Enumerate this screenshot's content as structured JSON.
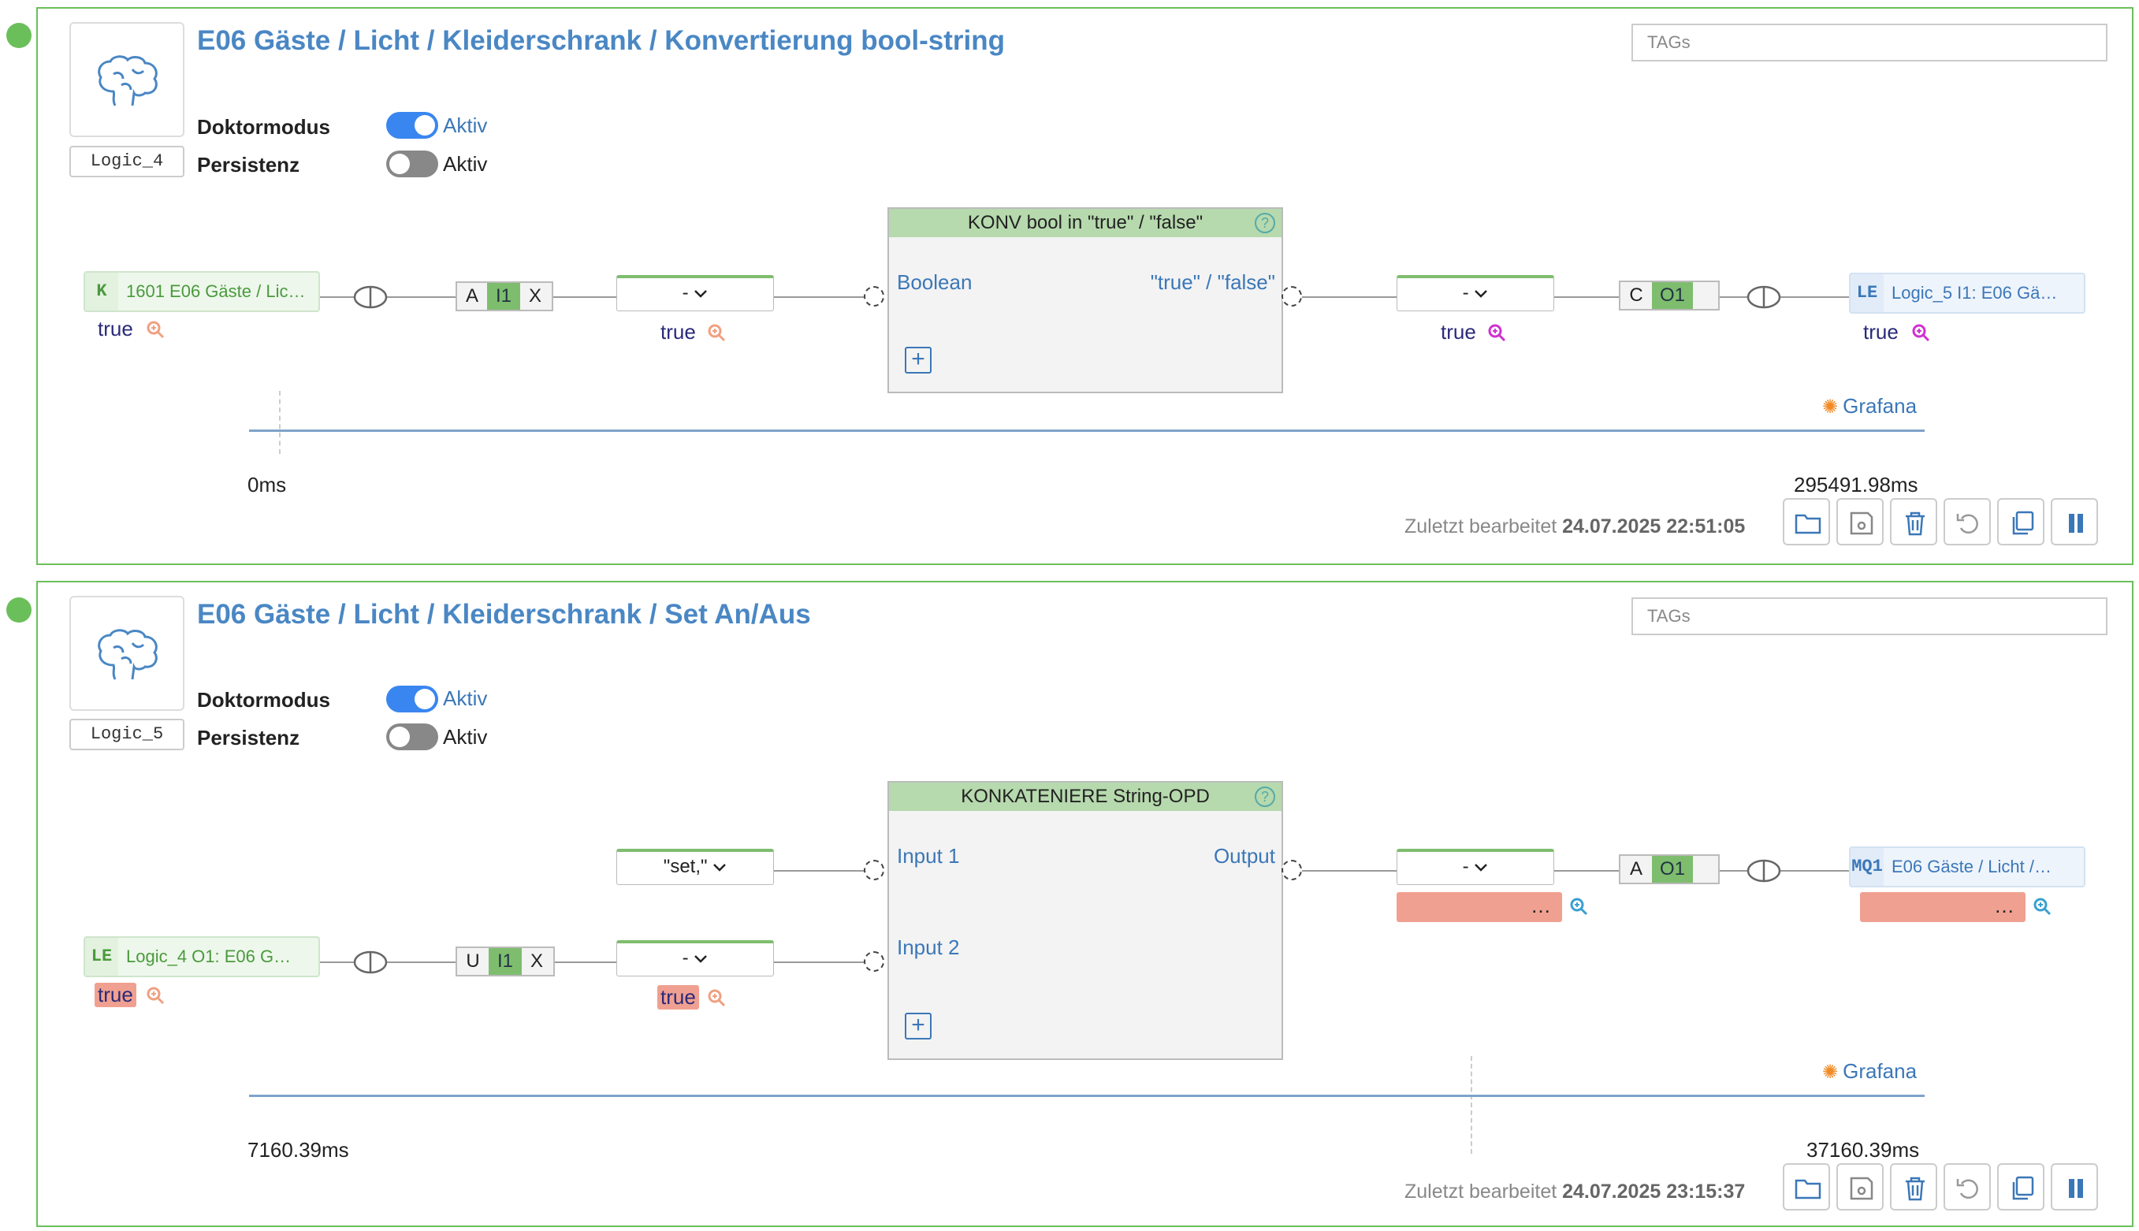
{
  "logics": [
    {
      "title": "E06 Gäste / Licht / Kleiderschrank / Konvertierung bool-string",
      "id": "Logic_4",
      "tags_placeholder": "TAGs",
      "doctor_label": "Doktormodus",
      "doctor_state": "Aktiv",
      "persist_label": "Persistenz",
      "persist_state": "Aktiv",
      "input_node": {
        "tag": "K",
        "text": "1601 E06 Gäste / Lic…",
        "value": "true"
      },
      "input_trigger": [
        "A",
        "I1",
        "X"
      ],
      "input_select": {
        "label": "- ",
        "value": "true"
      },
      "block": {
        "title": "KONV bool in \"true\" / \"false\"",
        "help": "?",
        "inputs": [
          "Boolean"
        ],
        "outputs": [
          "\"true\" / \"false\""
        ],
        "add": "+"
      },
      "output_select": {
        "label": "- ",
        "value": "true"
      },
      "output_trigger": [
        "C",
        "O1"
      ],
      "output_node": {
        "tag": "LE",
        "text": "Logic_5 I1: E06 Gä…",
        "value": "true"
      },
      "grafana": "Grafana",
      "time_start": "0ms",
      "time_end": "295491.98ms",
      "edited_label": "Zuletzt bearbeitet",
      "edited_date": "24.07.2025 22:51:05"
    },
    {
      "title": "E06 Gäste / Licht / Kleiderschrank / Set An/Aus",
      "id": "Logic_5",
      "tags_placeholder": "TAGs",
      "doctor_label": "Doktormodus",
      "doctor_state": "Aktiv",
      "persist_label": "Persistenz",
      "persist_state": "Aktiv",
      "const_select": {
        "label": "\"set,\" "
      },
      "input_node": {
        "tag": "LE",
        "text": "Logic_4 O1: E06 G…",
        "value": "true"
      },
      "input_trigger": [
        "U",
        "I1",
        "X"
      ],
      "input_select": {
        "label": "- ",
        "value": "true"
      },
      "block": {
        "title": "KONKATENIERE String-OPD",
        "help": "?",
        "inputs": [
          "Input 1",
          "Input 2"
        ],
        "outputs": [
          "Output"
        ],
        "add": "+"
      },
      "output_select": {
        "label": "- ",
        "value": "…"
      },
      "output_trigger": [
        "A",
        "O1"
      ],
      "output_node": {
        "tag": "MQ1",
        "text": "E06 Gäste / Licht /…",
        "value": "…"
      },
      "grafana": "Grafana",
      "time_start": "7160.39ms",
      "time_end": "37160.39ms",
      "edited_label": "Zuletzt bearbeitet",
      "edited_date": "24.07.2025 23:15:37"
    }
  ],
  "colors": {
    "accent": "#4a87c4",
    "panel_border": "#6bbf5a",
    "toggle_on": "#3a86f0",
    "error_value": "#f0a090"
  },
  "icons": [
    "brain-icon",
    "chevron-down-icon",
    "magnifier-icon",
    "plug-icon",
    "folder-icon",
    "save-icon",
    "trash-icon",
    "undo-icon",
    "copy-icon",
    "pause-icon",
    "grafana-icon",
    "help-icon"
  ]
}
